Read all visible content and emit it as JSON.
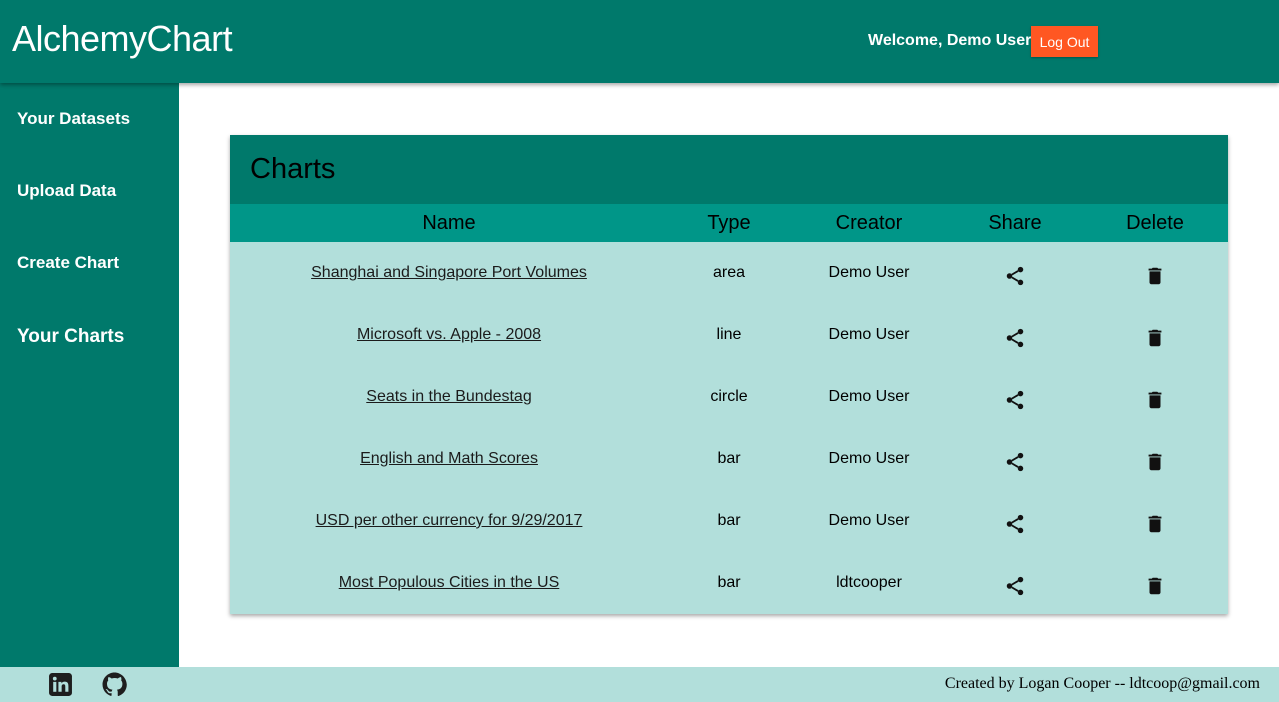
{
  "header": {
    "app_title": "AlchemyChart",
    "welcome": "Welcome, Demo User",
    "logout_label": "Log Out"
  },
  "sidebar": {
    "items": [
      {
        "label": "Your Datasets"
      },
      {
        "label": "Upload Data"
      },
      {
        "label": "Create Chart"
      },
      {
        "label": "Your Charts"
      }
    ]
  },
  "charts": {
    "title": "Charts",
    "columns": [
      "Name",
      "Type",
      "Creator",
      "Share",
      "Delete"
    ],
    "rows": [
      {
        "name": "Shanghai and Singapore Port Volumes",
        "type": "area",
        "creator": "Demo User",
        "share_icon": "share-icon",
        "delete_icon": "trash-icon"
      },
      {
        "name": "Microsoft vs. Apple - 2008",
        "type": "line",
        "creator": "Demo User",
        "share_icon": "share-icon",
        "delete_icon": "trash-icon"
      },
      {
        "name": "Seats in the Bundestag",
        "type": "circle",
        "creator": "Demo User",
        "share_icon": "share-icon",
        "delete_icon": "trash-icon"
      },
      {
        "name": "English and Math Scores",
        "type": "bar",
        "creator": "Demo User",
        "share_icon": "share-icon",
        "delete_icon": "trash-icon"
      },
      {
        "name": "USD per other currency for 9/29/2017",
        "type": "bar",
        "creator": "Demo User",
        "share_icon": "share-icon",
        "delete_icon": "trash-icon"
      },
      {
        "name": "Most Populous Cities in the US",
        "type": "bar",
        "creator": "ldtcooper",
        "share_icon": "share-icon",
        "delete_icon": "trash-icon"
      }
    ]
  },
  "footer": {
    "icons": [
      "linkedin-icon",
      "github-icon"
    ],
    "credits": "Created by Logan Cooper -- ldtcoop@gmail.com"
  },
  "colors": {
    "primary": "#00796b",
    "header_row": "#009688",
    "table_body": "#b2dfdb",
    "accent": "#ff5722"
  }
}
